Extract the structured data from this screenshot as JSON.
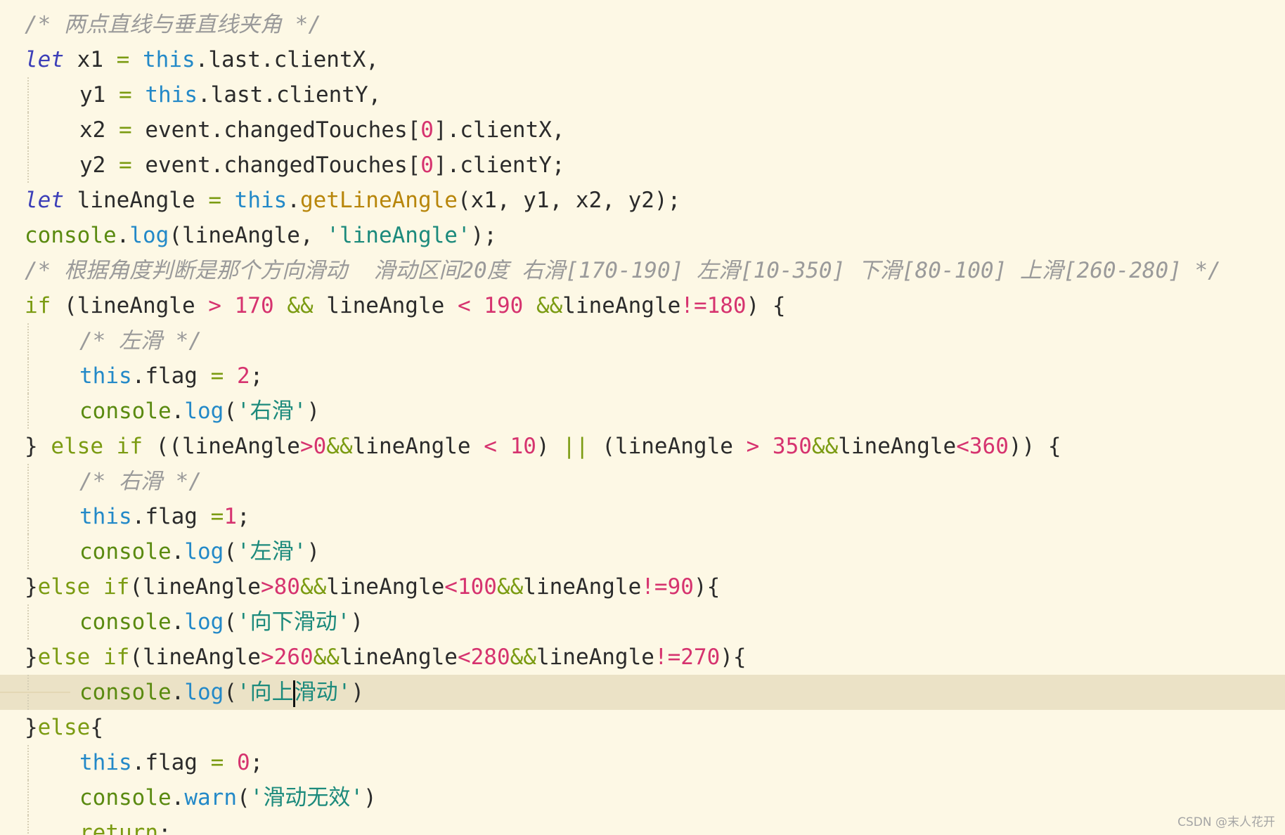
{
  "colors": {
    "background": "#fdf8e5",
    "active_line": "#ebe2c6",
    "keyword": "#7b9b12",
    "let_keyword": "#3c3fb8",
    "this_keyword": "#2389c8",
    "number": "#d6336f",
    "string": "#1c8a7c",
    "function_name": "#b8860b",
    "comment": "#9a9a9a"
  },
  "code_lines": [
    {
      "indent": 0,
      "tokens": [
        [
          "cmt",
          "/* 两点直线与垂直线夹角 */"
        ]
      ]
    },
    {
      "indent": 0,
      "tokens": [
        [
          "kw2",
          "let"
        ],
        [
          "id",
          " x1 "
        ],
        [
          "op",
          "="
        ],
        [
          "id",
          " "
        ],
        [
          "this",
          "this"
        ],
        [
          "punc",
          ".last.clientX,"
        ]
      ]
    },
    {
      "indent": 1,
      "guide": true,
      "tokens": [
        [
          "id",
          "y1 "
        ],
        [
          "op",
          "="
        ],
        [
          "id",
          " "
        ],
        [
          "this",
          "this"
        ],
        [
          "punc",
          ".last.clientY,"
        ]
      ]
    },
    {
      "indent": 1,
      "guide": true,
      "tokens": [
        [
          "id",
          "x2 "
        ],
        [
          "op",
          "="
        ],
        [
          "id",
          " event.changedTouches["
        ],
        [
          "num",
          "0"
        ],
        [
          "punc",
          "].clientX,"
        ]
      ]
    },
    {
      "indent": 1,
      "guide": true,
      "tokens": [
        [
          "id",
          "y2 "
        ],
        [
          "op",
          "="
        ],
        [
          "id",
          " event.changedTouches["
        ],
        [
          "num",
          "0"
        ],
        [
          "punc",
          "].clientY;"
        ]
      ]
    },
    {
      "indent": 0,
      "tokens": [
        [
          "kw2",
          "let"
        ],
        [
          "id",
          " lineAngle "
        ],
        [
          "op",
          "="
        ],
        [
          "id",
          " "
        ],
        [
          "this",
          "this"
        ],
        [
          "punc",
          "."
        ],
        [
          "fn",
          "getLineAngle"
        ],
        [
          "punc",
          "(x1, y1, x2, y2);"
        ]
      ]
    },
    {
      "indent": 0,
      "tokens": [
        [
          "console",
          "console"
        ],
        [
          "punc",
          "."
        ],
        [
          "method",
          "log"
        ],
        [
          "punc",
          "(lineAngle, "
        ],
        [
          "str",
          "'lineAngle'"
        ],
        [
          "punc",
          ");"
        ]
      ]
    },
    {
      "indent": 0,
      "tokens": [
        [
          "cmt",
          "/* 根据角度判断是那个方向滑动  滑动区间20度 右滑[170-190] 左滑[10-350] 下滑[80-100] 上滑[260-280] */"
        ]
      ]
    },
    {
      "indent": 0,
      "tokens": [
        [
          "kw",
          "if"
        ],
        [
          "punc",
          " (lineAngle "
        ],
        [
          "cmp",
          ">"
        ],
        [
          "id",
          " "
        ],
        [
          "num",
          "170"
        ],
        [
          "id",
          " "
        ],
        [
          "op",
          "&&"
        ],
        [
          "id",
          " lineAngle "
        ],
        [
          "cmp",
          "<"
        ],
        [
          "id",
          " "
        ],
        [
          "num",
          "190"
        ],
        [
          "id",
          " "
        ],
        [
          "op",
          "&&"
        ],
        [
          "id",
          "lineAngle"
        ],
        [
          "cmp",
          "!="
        ],
        [
          "num",
          "180"
        ],
        [
          "punc",
          ") {"
        ]
      ]
    },
    {
      "indent": 1,
      "guide": true,
      "tokens": [
        [
          "cmt",
          "/* 左滑 */"
        ]
      ]
    },
    {
      "indent": 1,
      "guide": true,
      "tokens": [
        [
          "this",
          "this"
        ],
        [
          "punc",
          ".flag "
        ],
        [
          "op",
          "="
        ],
        [
          "id",
          " "
        ],
        [
          "num",
          "2"
        ],
        [
          "punc",
          ";"
        ]
      ]
    },
    {
      "indent": 1,
      "guide": true,
      "tokens": [
        [
          "console",
          "console"
        ],
        [
          "punc",
          "."
        ],
        [
          "method",
          "log"
        ],
        [
          "punc",
          "("
        ],
        [
          "str",
          "'右滑'"
        ],
        [
          "punc",
          ")"
        ]
      ]
    },
    {
      "indent": 0,
      "tokens": [
        [
          "punc",
          "} "
        ],
        [
          "kw",
          "else"
        ],
        [
          "id",
          " "
        ],
        [
          "kw",
          "if"
        ],
        [
          "punc",
          " ((lineAngle"
        ],
        [
          "cmp",
          ">"
        ],
        [
          "num",
          "0"
        ],
        [
          "op",
          "&&"
        ],
        [
          "id",
          "lineAngle "
        ],
        [
          "cmp",
          "<"
        ],
        [
          "id",
          " "
        ],
        [
          "num",
          "10"
        ],
        [
          "punc",
          ") "
        ],
        [
          "op",
          "||"
        ],
        [
          "punc",
          " (lineAngle "
        ],
        [
          "cmp",
          ">"
        ],
        [
          "id",
          " "
        ],
        [
          "num",
          "350"
        ],
        [
          "op",
          "&&"
        ],
        [
          "id",
          "lineAngle"
        ],
        [
          "cmp",
          "<"
        ],
        [
          "num",
          "360"
        ],
        [
          "punc",
          ")) {"
        ]
      ]
    },
    {
      "indent": 1,
      "guide": true,
      "tokens": [
        [
          "cmt",
          "/* 右滑 */"
        ]
      ]
    },
    {
      "indent": 1,
      "guide": true,
      "tokens": [
        [
          "this",
          "this"
        ],
        [
          "punc",
          ".flag "
        ],
        [
          "op",
          "="
        ],
        [
          "num",
          "1"
        ],
        [
          "punc",
          ";"
        ]
      ]
    },
    {
      "indent": 1,
      "guide": true,
      "tokens": [
        [
          "console",
          "console"
        ],
        [
          "punc",
          "."
        ],
        [
          "method",
          "log"
        ],
        [
          "punc",
          "("
        ],
        [
          "str",
          "'左滑'"
        ],
        [
          "punc",
          ")"
        ]
      ]
    },
    {
      "indent": 0,
      "tokens": [
        [
          "punc",
          "}"
        ],
        [
          "kw",
          "else"
        ],
        [
          "id",
          " "
        ],
        [
          "kw",
          "if"
        ],
        [
          "punc",
          "(lineAngle"
        ],
        [
          "cmp",
          ">"
        ],
        [
          "num",
          "80"
        ],
        [
          "op",
          "&&"
        ],
        [
          "id",
          "lineAngle"
        ],
        [
          "cmp",
          "<"
        ],
        [
          "num",
          "100"
        ],
        [
          "op",
          "&&"
        ],
        [
          "id",
          "lineAngle"
        ],
        [
          "cmp",
          "!="
        ],
        [
          "num",
          "90"
        ],
        [
          "punc",
          "){"
        ]
      ]
    },
    {
      "indent": 1,
      "guide": true,
      "tokens": [
        [
          "console",
          "console"
        ],
        [
          "punc",
          "."
        ],
        [
          "method",
          "log"
        ],
        [
          "punc",
          "("
        ],
        [
          "str",
          "'向下滑动'"
        ],
        [
          "punc",
          ")"
        ]
      ]
    },
    {
      "indent": 0,
      "tokens": [
        [
          "punc",
          "}"
        ],
        [
          "kw",
          "else"
        ],
        [
          "id",
          " "
        ],
        [
          "kw",
          "if"
        ],
        [
          "punc",
          "(lineAngle"
        ],
        [
          "cmp",
          ">"
        ],
        [
          "num",
          "260"
        ],
        [
          "op",
          "&&"
        ],
        [
          "id",
          "lineAngle"
        ],
        [
          "cmp",
          "<"
        ],
        [
          "num",
          "280"
        ],
        [
          "op",
          "&&"
        ],
        [
          "id",
          "lineAngle"
        ],
        [
          "cmp",
          "!="
        ],
        [
          "num",
          "270"
        ],
        [
          "punc",
          "){"
        ]
      ]
    },
    {
      "indent": 1,
      "guide": true,
      "active": true,
      "tokens": [
        [
          "console",
          "console"
        ],
        [
          "punc",
          "."
        ],
        [
          "method",
          "log"
        ],
        [
          "punc",
          "("
        ],
        [
          "str",
          "'向上"
        ],
        [
          "caret",
          ""
        ],
        [
          "str",
          "滑动'"
        ],
        [
          "punc",
          ")"
        ]
      ]
    },
    {
      "indent": 0,
      "tokens": [
        [
          "punc",
          "}"
        ],
        [
          "kw",
          "else"
        ],
        [
          "punc",
          "{"
        ]
      ]
    },
    {
      "indent": 1,
      "guide": true,
      "tokens": [
        [
          "this",
          "this"
        ],
        [
          "punc",
          ".flag "
        ],
        [
          "op",
          "="
        ],
        [
          "id",
          " "
        ],
        [
          "num",
          "0"
        ],
        [
          "punc",
          ";"
        ]
      ]
    },
    {
      "indent": 1,
      "guide": true,
      "tokens": [
        [
          "console",
          "console"
        ],
        [
          "punc",
          "."
        ],
        [
          "method",
          "warn"
        ],
        [
          "punc",
          "("
        ],
        [
          "str",
          "'滑动无效'"
        ],
        [
          "punc",
          ")"
        ]
      ]
    },
    {
      "indent": 1,
      "guide": true,
      "tokens": [
        [
          "kw",
          "return"
        ],
        [
          "punc",
          ";"
        ]
      ]
    }
  ],
  "watermark": "CSDN @末人花开"
}
